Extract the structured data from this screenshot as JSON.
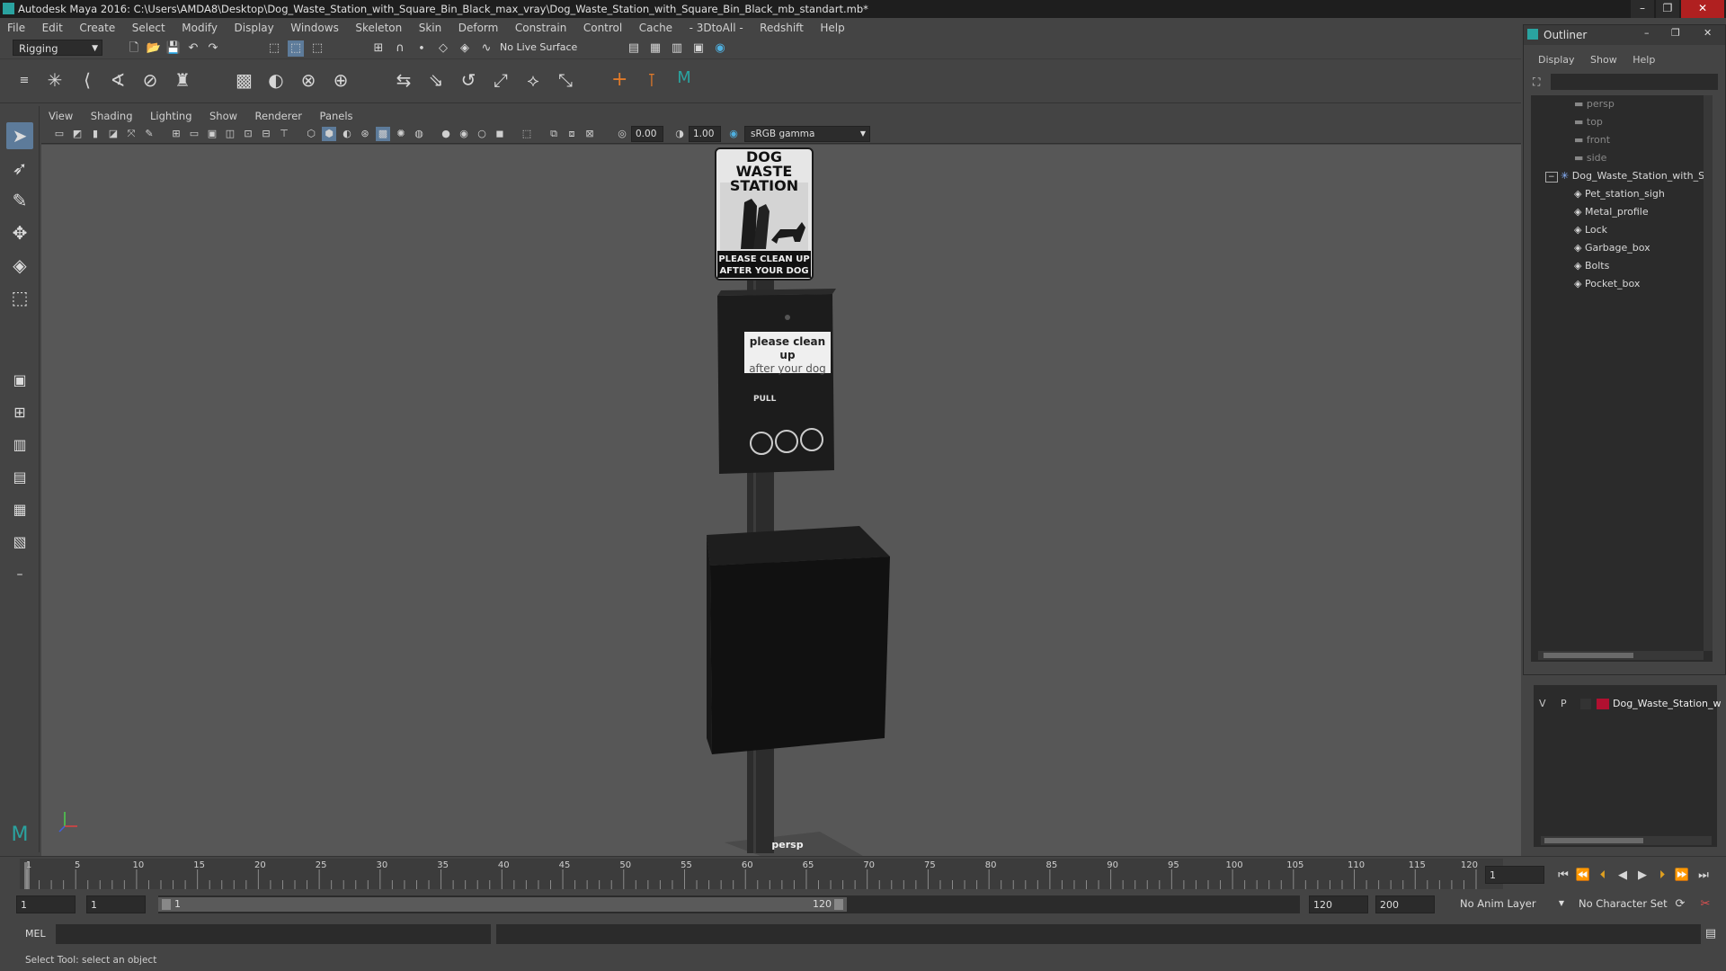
{
  "window": {
    "title": "Autodesk Maya 2016: C:\\Users\\AMDA8\\Desktop\\Dog_Waste_Station_with_Square_Bin_Black_max_vray\\Dog_Waste_Station_with_Square_Bin_Black_mb_standart.mb*",
    "controls": {
      "minimize": "–",
      "maximize": "❐",
      "close": "✕"
    }
  },
  "menubar": [
    "File",
    "Edit",
    "Create",
    "Select",
    "Modify",
    "Display",
    "Windows",
    "Skeleton",
    "Skin",
    "Deform",
    "Constrain",
    "Control",
    "Cache",
    "- 3DtoAll -",
    "Redshift",
    "Help"
  ],
  "shelf": {
    "mode": "Rigging",
    "live_surface": "No Live Surface"
  },
  "panel": {
    "menu": [
      "View",
      "Shading",
      "Lighting",
      "Show",
      "Renderer",
      "Panels"
    ],
    "exposure": "0.00",
    "gamma": "1.00",
    "color_space": "sRGB gamma",
    "camera_label": "persp"
  },
  "model": {
    "sign_title_line1": "DOG WASTE",
    "sign_title_line2": "STATION",
    "sign_footer_line1": "PLEASE CLEAN UP",
    "sign_footer_line2": "AFTER YOUR DOG",
    "dispenser_label_line1": "please clean up",
    "dispenser_label_line2": "after your dog",
    "pull_label": "PULL"
  },
  "outliner": {
    "title": "Outliner",
    "menu": [
      "Display",
      "Show",
      "Help"
    ],
    "cameras": [
      "persp",
      "top",
      "front",
      "side"
    ],
    "group": "Dog_Waste_Station_with_S",
    "children": [
      "Pet_station_sigh",
      "Metal_profile",
      "Lock",
      "Garbage_box",
      "Bolts",
      "Pocket_box"
    ]
  },
  "layers": {
    "v": "V",
    "p": "P",
    "layer_name": "Dog_Waste_Station_w",
    "layer_color": "#b01030"
  },
  "timeline": {
    "ticks": [
      "1",
      "5",
      "10",
      "15",
      "20",
      "25",
      "30",
      "35",
      "40",
      "45",
      "50",
      "55",
      "60",
      "65",
      "70",
      "75",
      "80",
      "85",
      "90",
      "95",
      "100",
      "105",
      "110",
      "115",
      "120"
    ],
    "current_frame": "1"
  },
  "range": {
    "start": "1",
    "playback_start": "1",
    "slider_start": "1",
    "slider_end": "120",
    "playback_end": "120",
    "end": "200",
    "anim_layer": "No Anim Layer",
    "character_set": "No Character Set"
  },
  "command": {
    "label": "MEL"
  },
  "help_line": "Select Tool: select an object"
}
